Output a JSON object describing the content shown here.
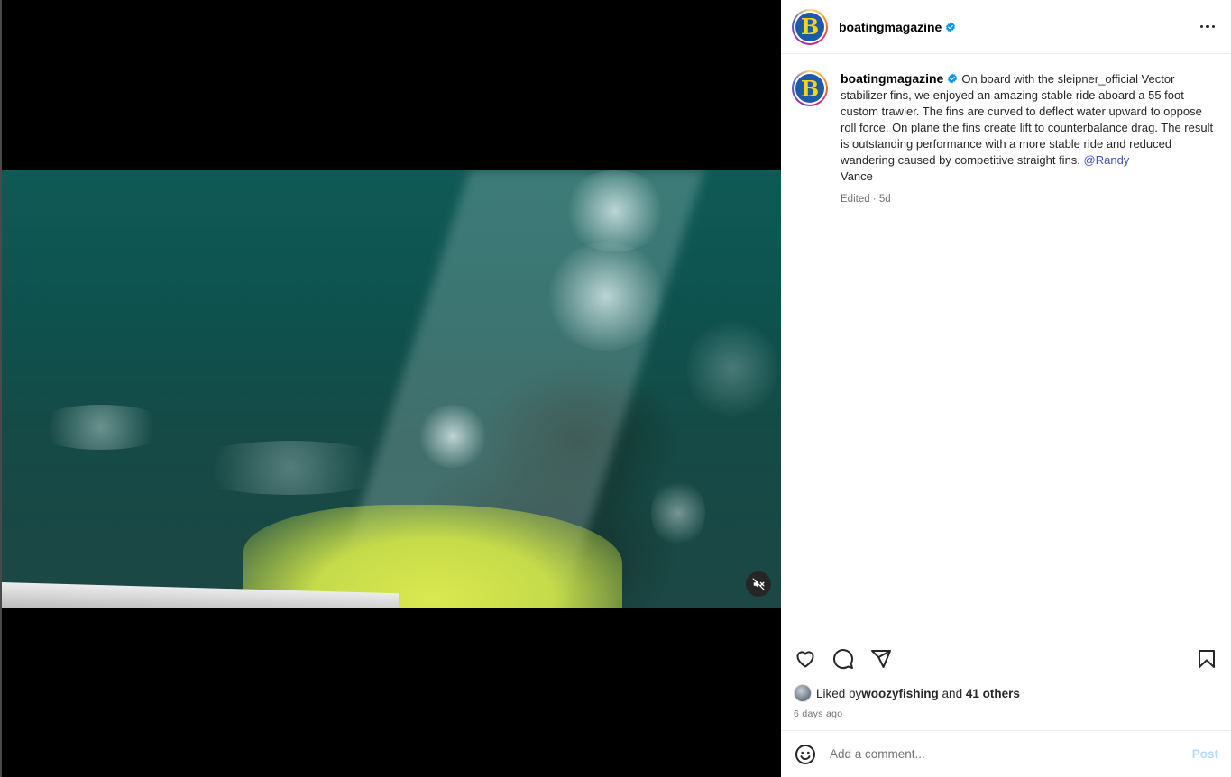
{
  "post": {
    "username": "boatingmagazine",
    "caption_lead": "On board with the sleipner_official Vector stabilizer fins, we enjoyed an amazing stable ride aboard a 55 foot custom trawler. The fins are curved to deflect water upward to oppose roll force. On plane the fins create lift to counterbalance drag. The result is outstanding performance with a more stable ride and reduced wandering caused by competitive straight fins. ",
    "mention": "@Randy",
    "caption_tail": "Vance",
    "edited_meta": "Edited · 5d",
    "liked_by_prefix": "Liked by ",
    "liked_by_user": "woozyfishing",
    "liked_by_and": " and ",
    "liked_by_others": "41 others",
    "date": "6 days ago"
  },
  "comment": {
    "placeholder": "Add a comment...",
    "post_label": "Post"
  },
  "icons": {
    "avatar_letter": "B",
    "mute": "volume-off-icon",
    "more": "more-options-icon",
    "like": "heart-icon",
    "comment": "comment-icon",
    "share": "send-icon",
    "save": "bookmark-icon",
    "emoji": "emoji-icon",
    "verified": "verified-badge-icon"
  },
  "colors": {
    "verified": "#0095f6",
    "post_disabled": "#b3dbff",
    "logo_bg": "#1d5aa8",
    "logo_letter": "#f7d417"
  }
}
